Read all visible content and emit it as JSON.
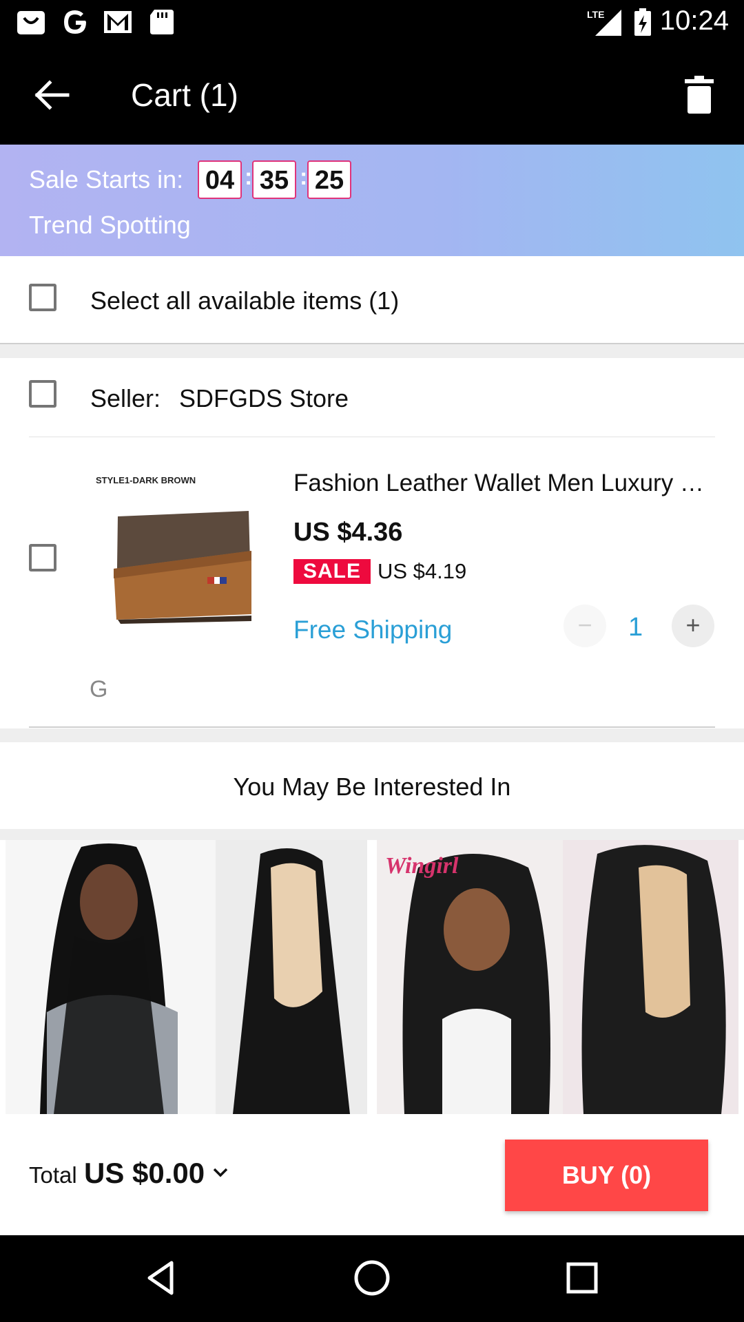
{
  "status_bar": {
    "time": "10:24",
    "network": "LTE"
  },
  "app_bar": {
    "title": "Cart (1)"
  },
  "sale_banner": {
    "label": "Sale Starts in:",
    "hours": "04",
    "minutes": "35",
    "seconds": "25",
    "separator": ":",
    "subtitle": "Trend Spotting"
  },
  "select_all": {
    "label": "Select all available items (1)"
  },
  "seller": {
    "prefix": "Seller:",
    "name": "SDFGDS Store"
  },
  "product": {
    "image_caption": "STYLE1-DARK BROWN",
    "title": "Fashion Leather Wallet Men Luxury …",
    "price": "US $4.36",
    "sale_badge": "SALE",
    "sale_price": "US $4.19",
    "shipping": "Free Shipping",
    "quantity": "1",
    "minus": "−",
    "plus": "+",
    "footer_label": "G"
  },
  "recommendations": {
    "title": "You May Be Interested In",
    "brand_text": "Wingirl"
  },
  "bottom_bar": {
    "total_label": "Total",
    "total_amount": "US $0.00",
    "buy_label": "BUY (0)"
  },
  "colors": {
    "accent": "#ff4747",
    "link": "#2a9fd6",
    "sale": "#ee0a3e"
  }
}
